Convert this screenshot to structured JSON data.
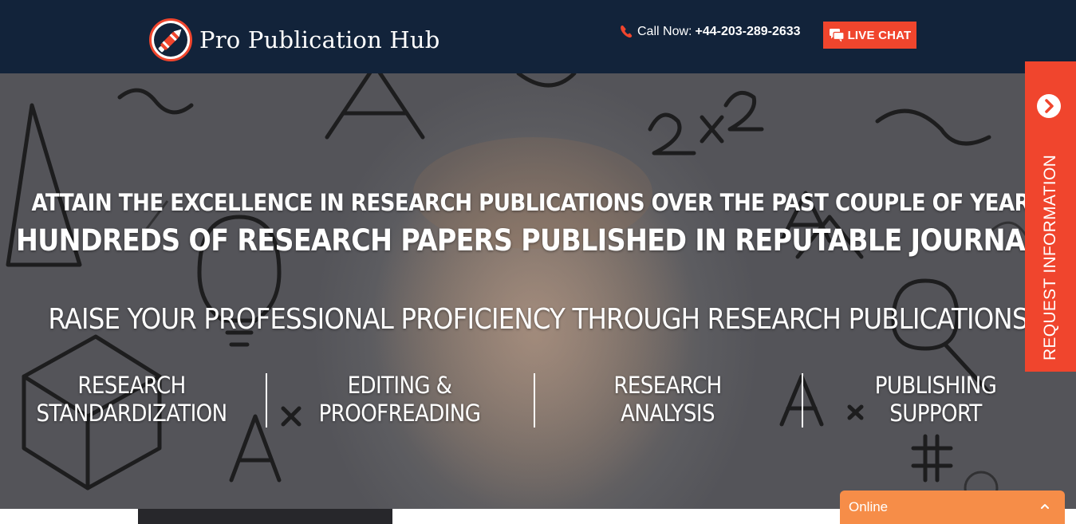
{
  "header": {
    "brand": "Pro Publication Hub",
    "call_label": "Call Now:",
    "phone": "+44-203-289-2633",
    "live_chat": "LIVE CHAT"
  },
  "hero": {
    "line1": "ATTAIN THE EXCELLENCE IN RESEARCH PUBLICATIONS OVER THE PAST COUPLE OF YEARS",
    "line2": "HUNDREDS OF RESEARCH PAPERS PUBLISHED IN REPUTABLE JOURNALS",
    "line3": "RAISE YOUR PROFESSIONAL PROFICIENCY THROUGH RESEARCH PUBLICATIONS",
    "features": [
      {
        "line1": "RESEARCH",
        "line2": "STANDARDIZATION"
      },
      {
        "line1": "EDITING &",
        "line2": "PROOFREADING"
      },
      {
        "line1": "RESEARCH",
        "line2": "ANALYSIS"
      },
      {
        "line1": "PUBLISHING",
        "line2": "SUPPORT"
      }
    ]
  },
  "sidebar": {
    "request_info": "REQUEST INFORMATION"
  },
  "chat": {
    "status": "Online"
  },
  "colors": {
    "header_bg": "#12233a",
    "accent_red": "#f0452d",
    "chat_orange": "#f68d48"
  },
  "icons": [
    "pen-logo-icon",
    "phone-icon",
    "chat-bubble-icon",
    "chevron-right-circle-icon",
    "chevron-up-icon"
  ]
}
